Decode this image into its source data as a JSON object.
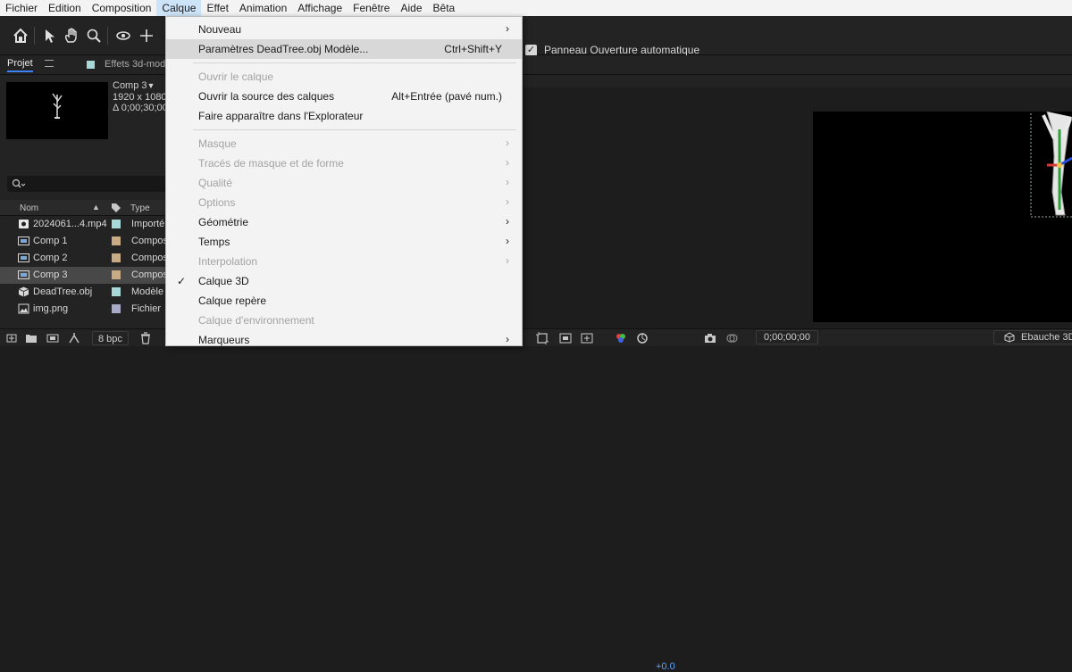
{
  "menubar": {
    "items": [
      "Fichier",
      "Edition",
      "Composition",
      "Calque",
      "Effet",
      "Animation",
      "Affichage",
      "Fenêtre",
      "Aide",
      "Bêta"
    ],
    "active_index": 3
  },
  "toolbar": {
    "auto_open_label": "Panneau Ouverture automatique",
    "auto_open_checked": true
  },
  "project": {
    "tab_label": "Projet",
    "effects_tab_label": "Effets 3d-mod",
    "selected_item": {
      "name": "Comp 3",
      "dimensions": "1920 x 1080",
      "duration": "Δ 0;00;30;00,"
    },
    "columns": {
      "name": "Nom",
      "type": "Type"
    },
    "items": [
      {
        "name": "2024061...4.mp4",
        "type": "Importé",
        "icon": "video-icon",
        "label_color": "#a8d8d8"
      },
      {
        "name": "Comp 1",
        "type": "Compos",
        "icon": "composition-icon",
        "label_color": "#c8ab84"
      },
      {
        "name": "Comp 2",
        "type": "Compos",
        "icon": "composition-icon",
        "label_color": "#c8ab84"
      },
      {
        "name": "Comp 3",
        "type": "Compos",
        "icon": "composition-icon",
        "label_color": "#c8ab84",
        "selected": true
      },
      {
        "name": "DeadTree.obj",
        "type": "Modèle",
        "icon": "3d-model-icon",
        "label_color": "#a8d8d8"
      },
      {
        "name": "img.png",
        "type": "Fichier",
        "icon": "image-icon",
        "label_color": "#a9a9c8"
      }
    ]
  },
  "dropdown": {
    "items": [
      {
        "label": "Nouveau",
        "submenu": true,
        "enabled": true
      },
      {
        "label": "Paramètres DeadTree.obj Modèle...",
        "shortcut": "Ctrl+Shift+Y",
        "enabled": true,
        "highlighted": true
      },
      {
        "separator": true
      },
      {
        "label": "Ouvrir le calque",
        "enabled": false
      },
      {
        "label": "Ouvrir la source des calques",
        "shortcut": "Alt+Entrée (pavé num.)",
        "enabled": true
      },
      {
        "label": "Faire apparaître dans l'Explorateur",
        "enabled": true
      },
      {
        "separator": true
      },
      {
        "label": "Masque",
        "submenu": true,
        "enabled": false
      },
      {
        "label": "Tracés de masque et de forme",
        "submenu": true,
        "enabled": false
      },
      {
        "label": "Qualité",
        "submenu": true,
        "enabled": false
      },
      {
        "label": "Options",
        "submenu": true,
        "enabled": false
      },
      {
        "label": "Géométrie",
        "submenu": true,
        "enabled": true
      },
      {
        "label": "Temps",
        "submenu": true,
        "enabled": true
      },
      {
        "label": "Interpolation",
        "submenu": true,
        "enabled": false
      },
      {
        "label": "Calque 3D",
        "checked": true,
        "enabled": true
      },
      {
        "label": "Calque repère",
        "enabled": true
      },
      {
        "label": "Calque d'environnement",
        "enabled": false
      },
      {
        "label": "Marqueurs",
        "submenu": true,
        "enabled": true
      }
    ]
  },
  "bottombar": {
    "bpc_label": "8 bpc",
    "exposure_value": "+0.0",
    "timecode": "0;00;00;00",
    "renderer_label": "Ebauche 3D"
  },
  "colors": {
    "accent": "#3b82f6",
    "menu_highlight": "#cde3f7",
    "exposure": "#5aa0ff"
  }
}
